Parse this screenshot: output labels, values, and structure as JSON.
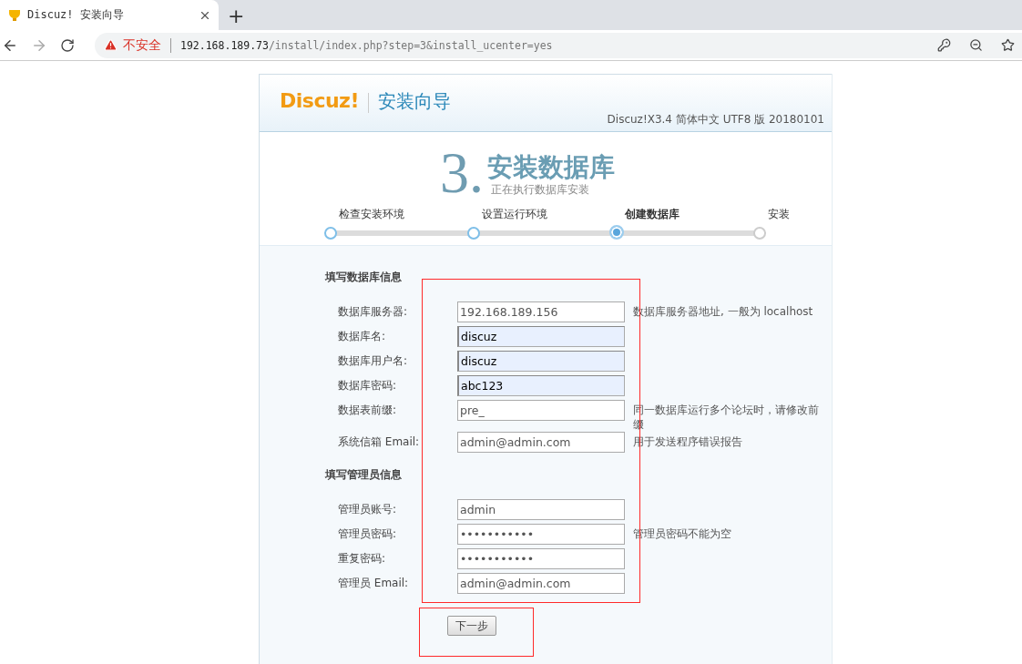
{
  "browser": {
    "tab_title": "Discuz! 安装向导",
    "new_tab": "+",
    "security_label": "不安全",
    "url_host": "192.168.189.73",
    "url_path": "/install/index.php?step=3&install_ucenter=yes"
  },
  "header": {
    "logo": "Discuz!",
    "title": "安装向导",
    "version": "Discuz!X3.4 简体中文 UTF8 版 20180101"
  },
  "step": {
    "number": "3.",
    "title": "安装数据库",
    "subtitle": "正在执行数据库安装"
  },
  "steps": [
    {
      "label": "检查安装环境",
      "completed": true,
      "selected": false
    },
    {
      "label": "设置运行环境",
      "completed": true,
      "selected": false
    },
    {
      "label": "创建数据库",
      "completed": false,
      "selected": true
    },
    {
      "label": "安装",
      "completed": false,
      "selected": false
    }
  ],
  "sections": [
    {
      "title": "填写数据库信息",
      "fields": [
        {
          "label": "数据库服务器:",
          "value": "192.168.189.156",
          "autofilled": false,
          "hint": "数据库服务器地址, 一般为 localhost"
        },
        {
          "label": "数据库名:",
          "value": "discuz",
          "autofilled": true
        },
        {
          "label": "数据库用户名:",
          "value": "discuz",
          "autofilled": true
        },
        {
          "label": "数据库密码:",
          "value": "abc123",
          "autofilled": true
        },
        {
          "label": "数据表前缀:",
          "value": "pre_",
          "autofilled": false,
          "hint": "同一数据库运行多个论坛时，请修改前缀"
        },
        {
          "label": "系统信箱 Email:",
          "value": "admin@admin.com",
          "autofilled": false,
          "hint": "用于发送程序错误报告"
        }
      ]
    },
    {
      "title": "填写管理员信息",
      "fields": [
        {
          "label": "管理员账号:",
          "value": "admin",
          "autofilled": false
        },
        {
          "label": "管理员密码:",
          "value": "•••••••••••",
          "autofilled": false,
          "hint": "管理员密码不能为空"
        },
        {
          "label": "重复密码:",
          "value": "•••••••••••",
          "autofilled": false
        },
        {
          "label": "管理员 Email:",
          "value": "admin@admin.com",
          "autofilled": false
        }
      ]
    }
  ],
  "submit": "下一步"
}
